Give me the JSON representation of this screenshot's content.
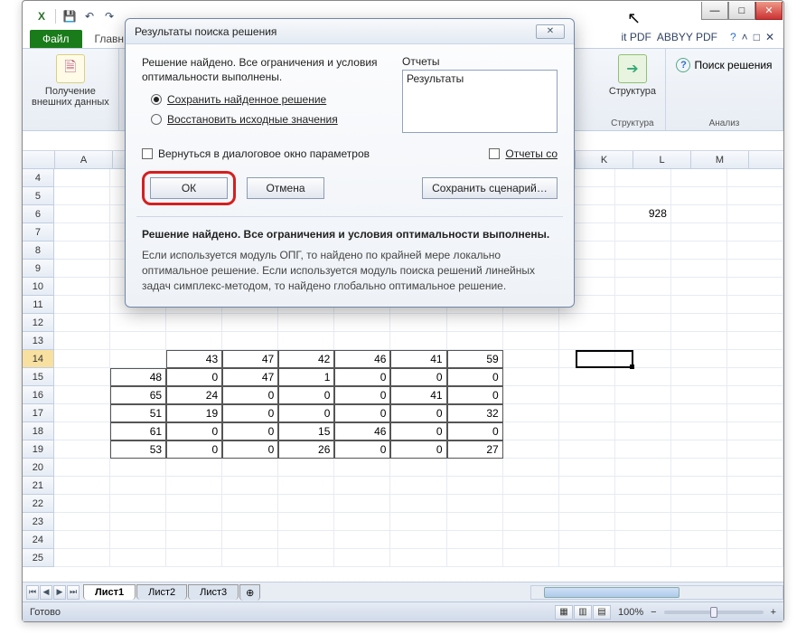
{
  "qat": {
    "excel_icon": "X",
    "save": "💾",
    "undo": "↶",
    "redo": "↷"
  },
  "window_buttons": {
    "min": "—",
    "max": "□",
    "close": "✕"
  },
  "tabs": {
    "file": "Файл",
    "home": "Главн",
    "nitpdf": "it PDF",
    "abbyy": "ABBYY PDF"
  },
  "help_icons": {
    "help": "?",
    "up": "˄",
    "win": "□",
    "x": "✕"
  },
  "ribbon": {
    "group1": {
      "btn": "Получение\nвнешних данных",
      "icon": "🗎"
    },
    "group_struct": {
      "label": "Структура",
      "icon": "➔"
    },
    "group_analysis": {
      "label": "Анализ",
      "solver": "Поиск решения",
      "solver_icon": "?"
    }
  },
  "columns": [
    "A",
    "",
    "",
    "",
    "",
    "",
    "",
    "",
    "",
    "K",
    "L",
    "M"
  ],
  "rows_start": 4,
  "rows_end": 25,
  "cells": {
    "K6": "928",
    "r14": {
      "C": "43",
      "D": "47",
      "E": "42",
      "F": "46",
      "G": "41",
      "H": "59"
    },
    "r15": {
      "B": "48",
      "C": "0",
      "D": "47",
      "E": "1",
      "F": "0",
      "G": "0",
      "H": "0"
    },
    "r16": {
      "B": "65",
      "C": "24",
      "D": "0",
      "E": "0",
      "F": "0",
      "G": "41",
      "H": "0"
    },
    "r17": {
      "B": "51",
      "C": "19",
      "D": "0",
      "E": "0",
      "F": "0",
      "G": "0",
      "H": "32"
    },
    "r18": {
      "B": "61",
      "C": "0",
      "D": "0",
      "E": "15",
      "F": "46",
      "G": "0",
      "H": "0"
    },
    "r19": {
      "B": "53",
      "C": "0",
      "D": "0",
      "E": "26",
      "F": "0",
      "G": "0",
      "H": "27"
    }
  },
  "sheet_tabs": {
    "s1": "Лист1",
    "s2": "Лист2",
    "s3": "Лист3",
    "new": "⊕"
  },
  "status": {
    "ready": "Готово",
    "zoom": "100%",
    "minus": "−",
    "plus": "+"
  },
  "dialog": {
    "title": "Результаты поиска решения",
    "close": "✕",
    "msg": "Решение найдено. Все ограничения и условия оптимальности выполнены.",
    "radio_keep": "Сохранить найденное решение",
    "radio_restore": "Восстановить исходные значения",
    "reports_label": "Отчеты",
    "reports_item": "Результаты",
    "chk_return": "Вернуться в диалоговое окно параметров",
    "chk_outline": "Отчеты со",
    "btn_ok": "ОК",
    "btn_cancel": "Отмена",
    "btn_save": "Сохранить сценарий…",
    "info_title": "Решение найдено. Все ограничения и условия оптимальности выполнены.",
    "info_text": "Если используется модуль ОПГ, то найдено по крайней мере локально оптимальное решение. Если используется модуль поиска решений линейных задач симплекс-методом, то найдено глобально оптимальное решение."
  }
}
